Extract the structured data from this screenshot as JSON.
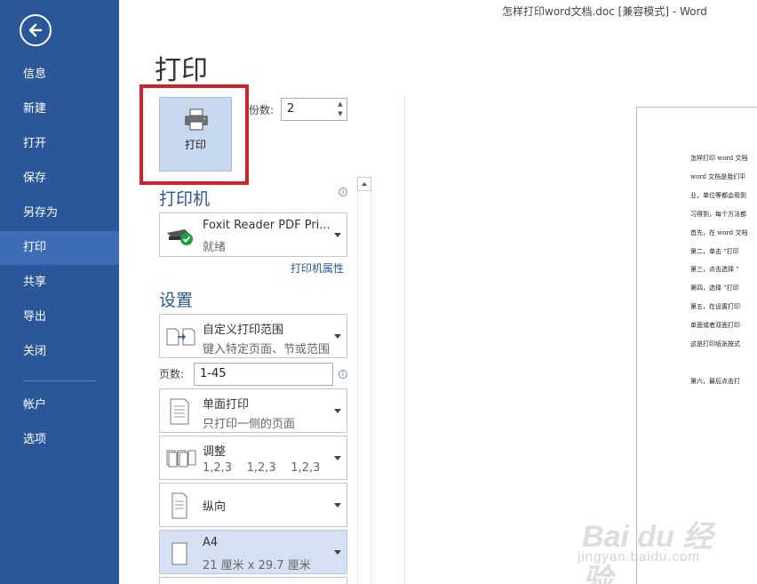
{
  "window": {
    "title": "怎样打印word文档.doc [兼容模式] - Word"
  },
  "sidebar": {
    "back_icon": "arrow-left-circle-icon",
    "items": [
      {
        "label": "信息"
      },
      {
        "label": "新建"
      },
      {
        "label": "打开"
      },
      {
        "label": "保存"
      },
      {
        "label": "另存为"
      },
      {
        "label": "打印"
      },
      {
        "label": "共享"
      },
      {
        "label": "导出"
      },
      {
        "label": "关闭"
      },
      {
        "label": "帐户"
      },
      {
        "label": "选项"
      }
    ],
    "active": "打印"
  },
  "page": {
    "title": "打印"
  },
  "print_button": {
    "label": "打印",
    "icon": "printer-icon"
  },
  "copies": {
    "label": "份数:",
    "value": "2"
  },
  "printer": {
    "section_title": "打印机",
    "name": "Foxit Reader PDF Pri...",
    "status": "就绪",
    "properties_link": "打印机属性"
  },
  "settings": {
    "section_title": "设置",
    "range": {
      "main": "自定义打印范围",
      "sub": "键入特定页面、节或范围"
    },
    "pages": {
      "label": "页数:",
      "value": "1-45"
    },
    "sides": {
      "main": "单面打印",
      "sub": "只打印一侧的页面"
    },
    "collate": {
      "main": "调整",
      "sub": "1,2,3    1,2,3    1,2,3"
    },
    "orientation": {
      "main": "纵向"
    },
    "paper": {
      "main": "A4",
      "sub": "21 厘米 x 29.7 厘米"
    }
  },
  "preview": {
    "lines": [
      "怎样打印 word 文档",
      "word 文档是我们平",
      "业，单位等都会用到",
      "习得到，每个方法都",
      "首先，在 word 文档",
      "第二，单击 “打印",
      "第三，点击选择 “",
      "第四，选择 “打印",
      "第五，在设置打印",
      "单面或者双面打印",
      "这是打印纸张按式",
      "第六，最后点击打"
    ]
  },
  "watermark": {
    "brand": "Bai du 经验",
    "url": "jingyan.baidu.com"
  },
  "colors": {
    "sidebar": "#2b579a",
    "active": "#3e6db5",
    "highlight": "#d2202e",
    "accent": "#2b579a"
  }
}
